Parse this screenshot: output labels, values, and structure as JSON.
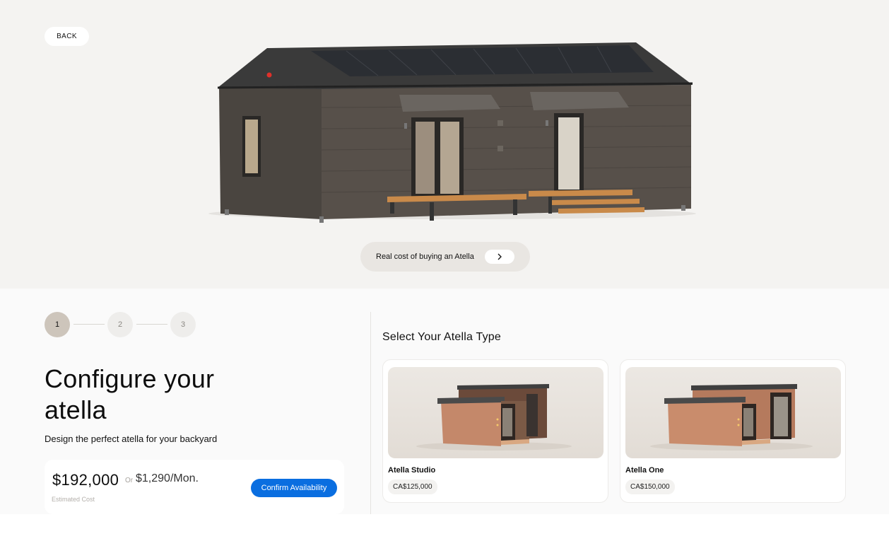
{
  "header": {
    "back_label": "BACK",
    "cost_link_label": "Real cost of buying an Atella",
    "cost_link_icon": "chevron-right-icon"
  },
  "stepper": {
    "steps": [
      "1",
      "2",
      "3"
    ],
    "active": 1
  },
  "configurator": {
    "title": "Configure your atella",
    "subtitle": "Design the perfect atella for your backyard",
    "price": "$192,000",
    "or_label": "Or",
    "monthly": "$1,290/Mon.",
    "estimated_label": "Estimated Cost",
    "confirm_label": "Confirm Availability"
  },
  "types": {
    "heading": "Select Your Atella Type",
    "items": [
      {
        "name": "Atella Studio",
        "price": "CA$125,000"
      },
      {
        "name": "Atella One",
        "price": "CA$150,000"
      }
    ]
  },
  "colors": {
    "accent": "#0a6ee0",
    "step_active": "#cdc5bb",
    "hero_bg": "#f4f3f1"
  }
}
